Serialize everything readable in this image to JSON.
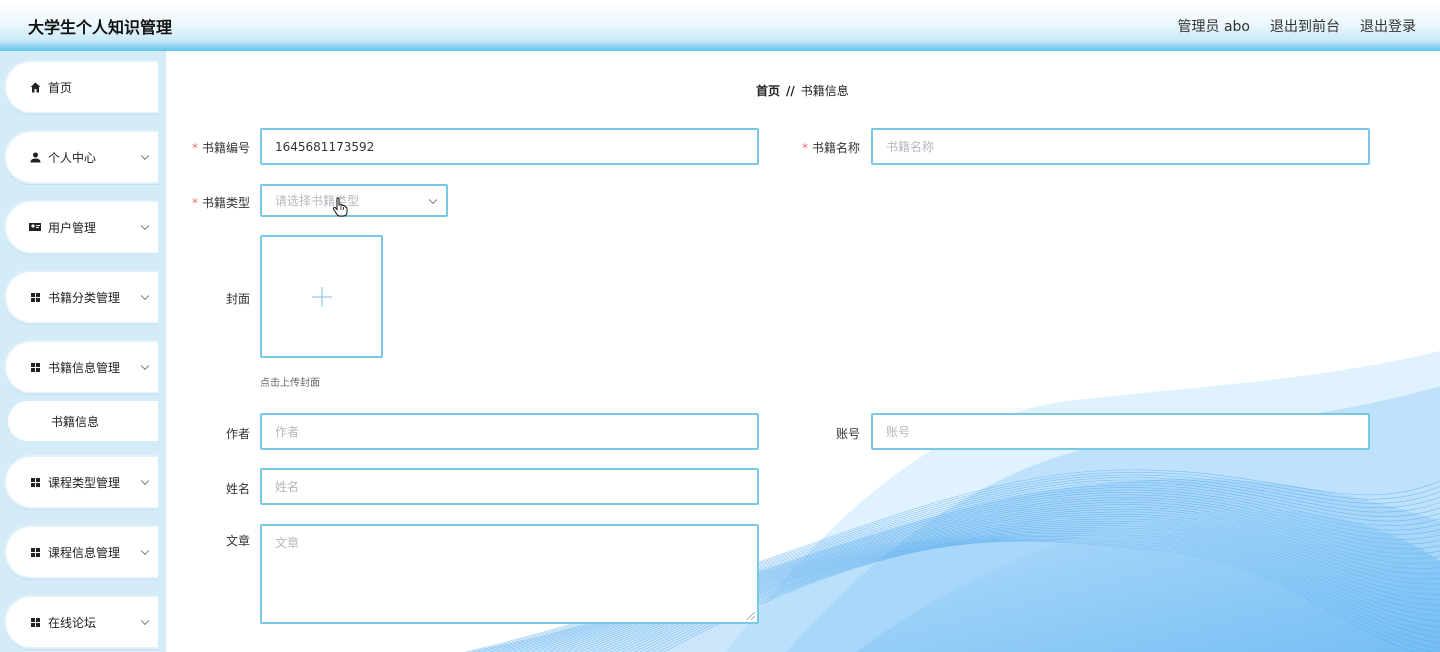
{
  "header": {
    "title": "大学生个人知识管理",
    "admin": "管理员 abo",
    "to_front": "退出到前台",
    "logout": "退出登录"
  },
  "sidebar": {
    "items": [
      {
        "label": "首页",
        "icon": "home-icon"
      },
      {
        "label": "个人中心",
        "icon": "user-icon"
      },
      {
        "label": "用户管理",
        "icon": "users-icon"
      },
      {
        "label": "书籍分类管理",
        "icon": "grid-icon"
      },
      {
        "label": "书籍信息管理",
        "icon": "grid-icon"
      },
      {
        "label": "书籍信息",
        "icon": ""
      },
      {
        "label": "课程类型管理",
        "icon": "grid-icon"
      },
      {
        "label": "课程信息管理",
        "icon": "grid-icon"
      },
      {
        "label": "在线论坛",
        "icon": "grid-icon"
      }
    ]
  },
  "breadcrumb": {
    "home": "首页",
    "separator": "//",
    "current": "书籍信息"
  },
  "form": {
    "book_no": {
      "label": "书籍编号",
      "value": "1645681173592"
    },
    "book_name": {
      "label": "书籍名称",
      "placeholder": "书籍名称"
    },
    "book_type": {
      "label": "书籍类型",
      "placeholder": "请选择书籍类型"
    },
    "cover": {
      "label": "封面",
      "hint": "点击上传封面"
    },
    "author": {
      "label": "作者",
      "placeholder": "作者"
    },
    "account": {
      "label": "账号",
      "placeholder": "账号"
    },
    "name": {
      "label": "姓名",
      "placeholder": "姓名"
    },
    "article": {
      "label": "文章",
      "placeholder": "文章"
    }
  },
  "colors": {
    "accent": "#5fc2ee",
    "field_border": "#78c8e6",
    "sidebar_bg": "#d3ecf8",
    "required": "#f56c6c"
  }
}
